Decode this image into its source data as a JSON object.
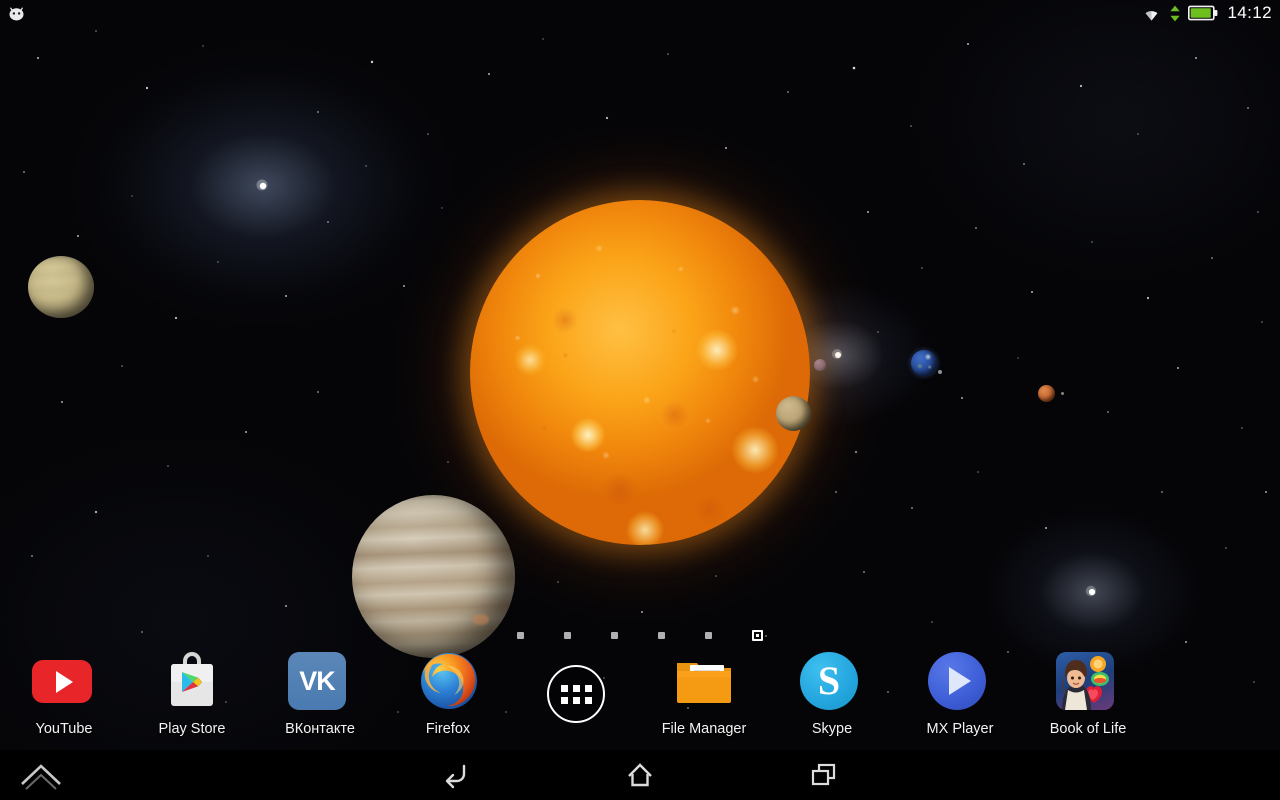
{
  "status_bar": {
    "notification_icon": "android-robot-icon",
    "wifi_icon": "wifi-icon",
    "data_transfer_icon": "data-updown-arrows-icon",
    "battery_icon": "battery-icon",
    "clock": "14:12",
    "battery_color": "#6cbf1f"
  },
  "wallpaper": {
    "name": "solar-system-live-wallpaper",
    "objects": [
      {
        "name": "sun",
        "color": "#fba418"
      },
      {
        "name": "saturn",
        "color": "#c6b887"
      },
      {
        "name": "jupiter",
        "color": "#c3b8a2"
      },
      {
        "name": "venus",
        "color": "#bda678"
      },
      {
        "name": "mercury",
        "color": "#8d6b72"
      },
      {
        "name": "earth",
        "color": "#2a4f9e"
      },
      {
        "name": "mars",
        "color": "#cd6f34"
      }
    ]
  },
  "page_indicator": {
    "total_pages": 6,
    "current_page": 6
  },
  "dock": {
    "app_drawer_label": "app-drawer",
    "items": [
      {
        "label": "YouTube",
        "icon": "youtube-icon"
      },
      {
        "label": "Play Store",
        "icon": "play-store-icon"
      },
      {
        "label": "ВКонтакте",
        "icon": "vk-icon"
      },
      {
        "label": "Firefox",
        "icon": "firefox-icon"
      },
      {
        "label": "File Manager",
        "icon": "file-manager-icon"
      },
      {
        "label": "Skype",
        "icon": "skype-icon"
      },
      {
        "label": "MX Player",
        "icon": "mx-player-icon"
      },
      {
        "label": "Book of Life",
        "icon": "book-of-life-icon"
      }
    ],
    "vk_mark": "VK",
    "skype_mark": "S"
  },
  "nav_bar": {
    "expand_icon": "expand-chevron-icon",
    "back_icon": "back-icon",
    "home_icon": "home-icon",
    "recents_icon": "recent-apps-icon"
  }
}
